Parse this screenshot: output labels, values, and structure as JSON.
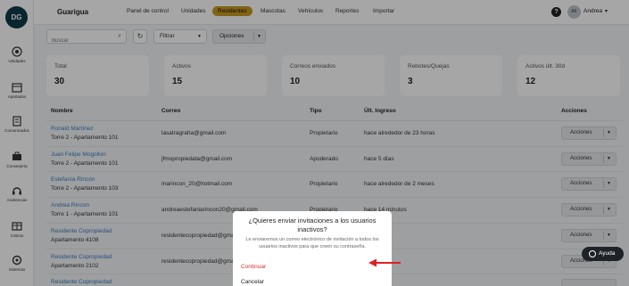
{
  "app": {
    "logo_text": "DG",
    "brand": "Guarigua"
  },
  "sidebar": {
    "items": [
      {
        "label": "Unidades",
        "icon": "building-icon"
      },
      {
        "label": "Apartados",
        "icon": "calendar-icon"
      },
      {
        "label": "Comunicados",
        "icon": "document-icon"
      },
      {
        "label": "Conserjería",
        "icon": "concierge-icon"
      },
      {
        "label": "Asistencias",
        "icon": "headset-icon"
      },
      {
        "label": "Cobros",
        "icon": "money-icon"
      },
      {
        "label": "Sistemas",
        "icon": "system-icon"
      }
    ]
  },
  "nav": {
    "items": [
      "Panel de control",
      "Unidades",
      "Residentes",
      "Mascotas",
      "Vehículos",
      "Reportes",
      "Importar"
    ],
    "active": "Residentes"
  },
  "user": {
    "initials": "AF",
    "name": "Andrea",
    "help_symbol": "?"
  },
  "toolbar": {
    "search_placeholder": "Buscar",
    "filter_label": "Filtrar",
    "options_label": "Opciones"
  },
  "stats": [
    {
      "label": "Total",
      "value": "30"
    },
    {
      "label": "Activos",
      "value": "15"
    },
    {
      "label": "Correos enviados",
      "value": "10"
    },
    {
      "label": "Rebotes/Quejas",
      "value": "3"
    },
    {
      "label": "Activos últ. 30d",
      "value": "12"
    }
  ],
  "table": {
    "headers": [
      "Nombre",
      "Correo",
      "Tipo",
      "Últ. Ingreso",
      "Acciones"
    ],
    "action_label": "Acciones",
    "rows": [
      {
        "name": "Ronald Martínez",
        "unit": "Torre 2 - Apartamento 101",
        "email": "lasatragraha@gmail.com",
        "type": "Propietario",
        "last": "hace alrededor de 23 horas"
      },
      {
        "name": "Juan Felipe Mogollon",
        "unit": "Torre 2 - Apartamento 101",
        "email": "jfmopropiedata@gmail.com",
        "type": "Apoderado",
        "last": "hace 5 días"
      },
      {
        "name": "Estefanía Rincón",
        "unit": "Torre 2 - Apartamento 103",
        "email": "marincon_20@hotmail.com",
        "type": "Propietario",
        "last": "hace alrededor de 2 meses"
      },
      {
        "name": "Andrea Rincon",
        "unit": "Torre 1 - Apartamento 101",
        "email": "andreaestefaniarincon20@gmail.com",
        "type": "Propietario",
        "last": "hace 14 minutos"
      },
      {
        "name": "Residente Copropiedad",
        "unit": "Apartamento 4108",
        "email": "residentecopropiedad@gmail.com",
        "type": "",
        "last": ""
      },
      {
        "name": "Residente Copropiedad",
        "unit": "Apartamento 2102",
        "email": "residentecopropiedad@gmail.co",
        "type": "",
        "last": ""
      },
      {
        "name": "Residente Copropiedad",
        "unit": "",
        "email": "",
        "type": "",
        "last": ""
      }
    ]
  },
  "dialog": {
    "title": "¿Quieres enviar invitaciones a los usuarios inactivos?",
    "body": "Le enviaremos un correo electrónico de invitación a todos los usuarios inactivos para que creen su contraseña.",
    "confirm": "Continuar",
    "cancel": "Cancelar"
  },
  "help_button": {
    "label": "Ayuda"
  },
  "colors": {
    "accent": "#c79a1e",
    "link": "#3a7ec4",
    "danger": "#d4342a",
    "arrow": "#e02020"
  }
}
